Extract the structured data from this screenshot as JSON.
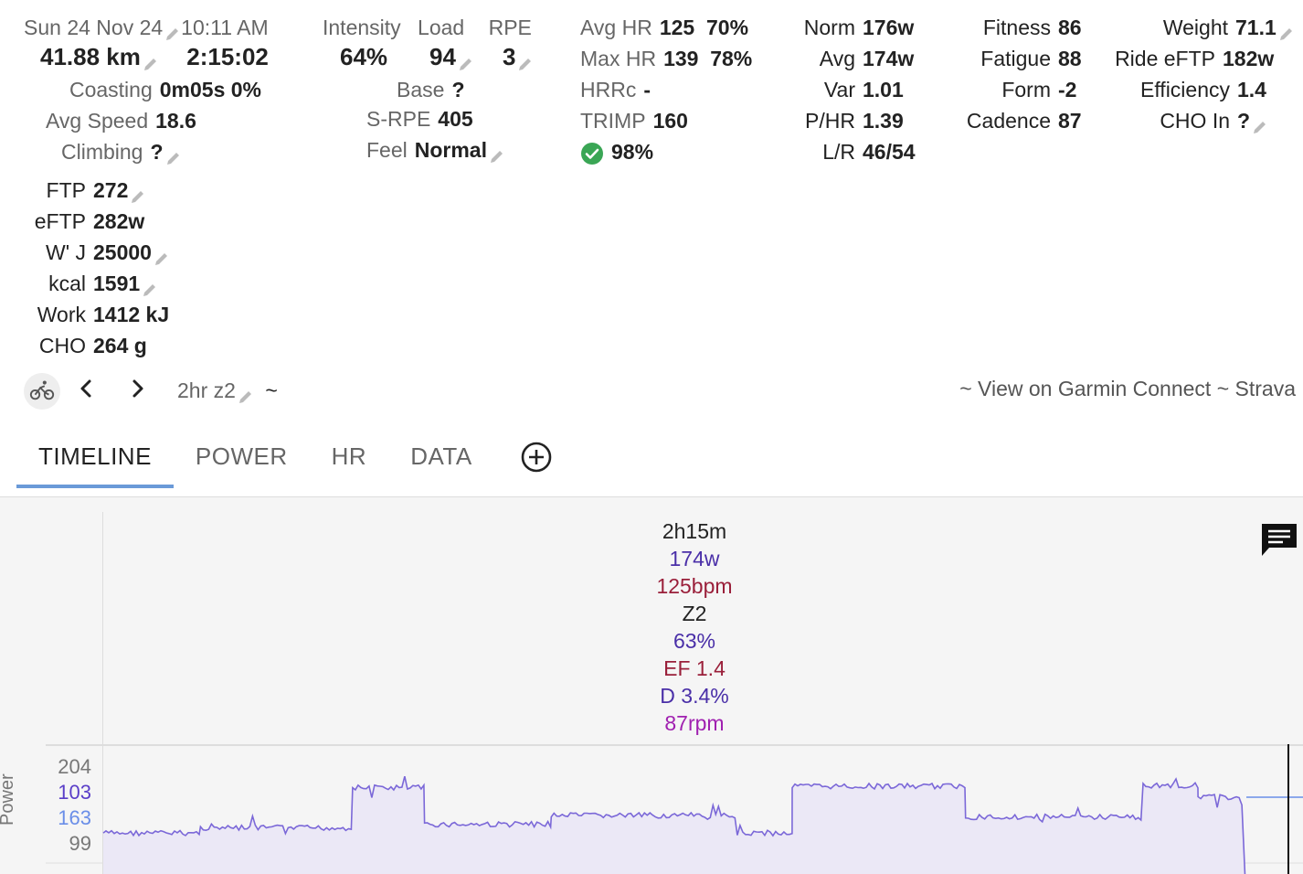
{
  "header": {
    "date": "Sun 24 Nov 24",
    "time": "10:11 AM",
    "distance": "41.88 km",
    "duration": "2:15:02",
    "coasting_label": "Coasting",
    "coasting_value": "0m05s  0%",
    "avg_speed_label": "Avg Speed",
    "avg_speed_value": "18.6",
    "climbing_label": "Climbing",
    "climbing_value": "?"
  },
  "load": {
    "intensity_label": "Intensity",
    "load_label": "Load",
    "rpe_label": "RPE",
    "intensity_value": "64%",
    "load_value": "94",
    "rpe_value": "3",
    "base_label": "Base",
    "base_value": "?",
    "srpe_label": "S-RPE",
    "srpe_value": "405",
    "feel_label": "Feel",
    "feel_value": "Normal"
  },
  "hr": {
    "avg_label": "Avg HR",
    "avg_value": "125  70%",
    "max_label": "Max HR",
    "max_value": "139  78%",
    "hrrc_label": "HRRc",
    "hrrc_value": "-",
    "trimp_label": "TRIMP",
    "trimp_value": "160",
    "check_value": "98%"
  },
  "power": {
    "norm_label": "Norm",
    "norm_value": "176w",
    "avg_label": "Avg",
    "avg_value": "174w",
    "var_label": "Var",
    "var_value": "1.01",
    "phr_label": "P/HR",
    "phr_value": "1.39",
    "lr_label": "L/R",
    "lr_value": "46/54"
  },
  "fitness": {
    "fitness_label": "Fitness",
    "fitness_value": "86",
    "fatigue_label": "Fatigue",
    "fatigue_value": "88",
    "form_label": "Form",
    "form_value": "-2",
    "cadence_label": "Cadence",
    "cadence_value": "87"
  },
  "weight": {
    "weight_label": "Weight",
    "weight_value": "71.1",
    "eftp_label": "Ride eFTP",
    "eftp_value": "182w",
    "eff_label": "Efficiency",
    "eff_value": "1.4",
    "cho_label": "CHO In",
    "cho_value": "?"
  },
  "settings": {
    "ftp_label": "FTP",
    "ftp_value": "272",
    "eftp_label": "eFTP",
    "eftp_value": "282w",
    "wj_label": "W' J",
    "wj_value": "25000",
    "kcal_label": "kcal",
    "kcal_value": "1591",
    "work_label": "Work",
    "work_value": "1412 kJ",
    "cho_label": "CHO",
    "cho_value": "264 g"
  },
  "nav": {
    "activity_name": "2hr z2",
    "tilde": "~",
    "links": "~ View on Garmin Connect ~ Strava"
  },
  "tabs": [
    {
      "label": "TIMELINE"
    },
    {
      "label": "POWER"
    },
    {
      "label": "HR"
    },
    {
      "label": "DATA"
    }
  ],
  "summary": {
    "duration": "2h15m",
    "power": "174w",
    "hr": "125bpm",
    "zone": "Z2",
    "intensity": "63%",
    "ef": "EF 1.4",
    "decoupling": "D 3.4%",
    "cadence": "87rpm"
  },
  "chart": {
    "axis_label": "Power",
    "ticks": [
      "204",
      "103",
      "163",
      "99"
    ],
    "colors": {
      "line": "#7b68d8",
      "fill": "#ebe8f6",
      "tick_grey": "#777777",
      "tick_purple": "#5a3ec8",
      "tick_blue": "#6a8ee8",
      "summary_purple": "#4a2fa8",
      "summary_red": "#9a1f3a",
      "summary_magenta": "#a020b0"
    }
  },
  "chart_data": {
    "type": "line",
    "title": "",
    "xlabel": "",
    "ylabel": "Power",
    "x_unit": "min",
    "x": [
      0,
      11.5,
      29.5,
      38,
      53,
      75,
      81.5,
      102,
      123,
      129.5,
      135
    ],
    "y": [
      101,
      105,
      108,
      163,
      113,
      125,
      122,
      101,
      165,
      161,
      150,
      123,
      103,
      166,
      155,
      2
    ]
  }
}
